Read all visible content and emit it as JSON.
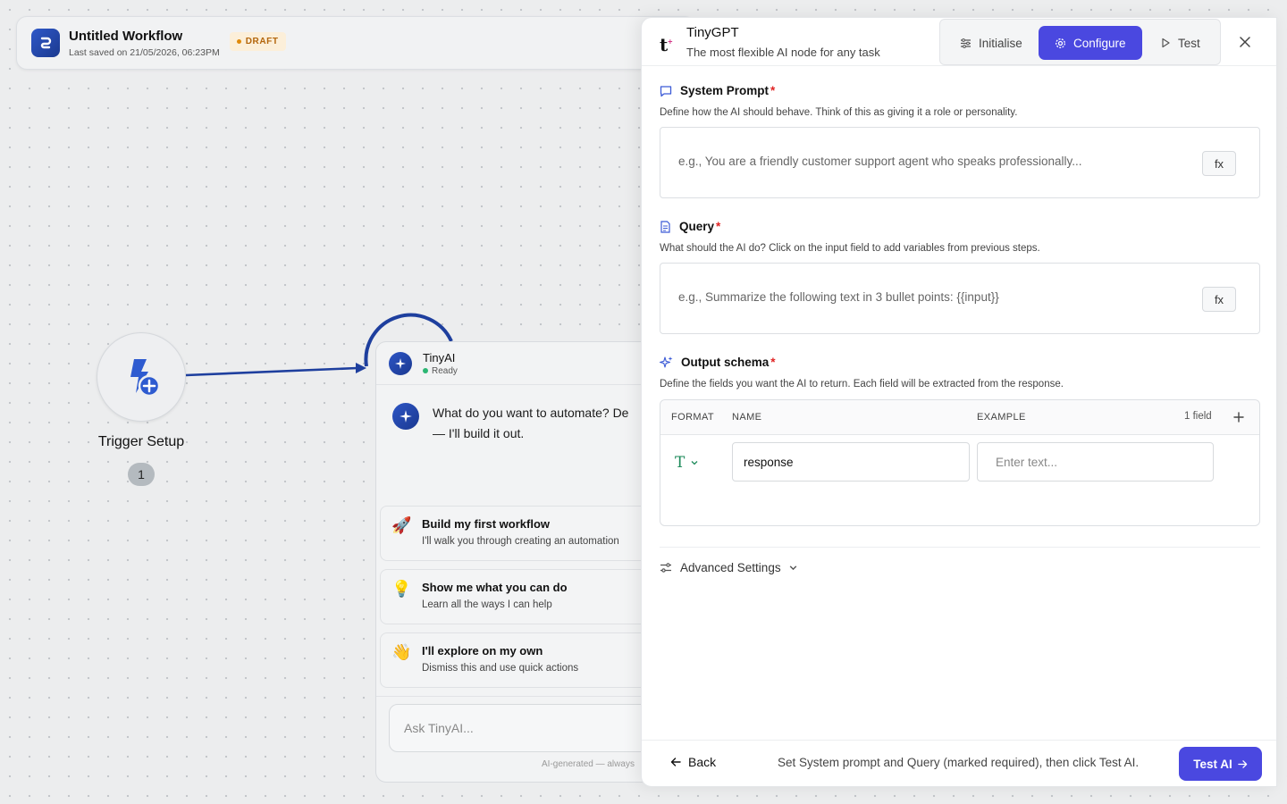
{
  "workflow": {
    "title": "Untitled Workflow",
    "last_saved": "Last saved on 21/05/2026, 06:23PM",
    "status_badge": "DRAFT",
    "logo_icon": "workflow-logo-icon"
  },
  "canvas": {
    "trigger": {
      "label": "Trigger Setup",
      "count": "1",
      "icon": "lightning-plus-icon"
    },
    "chat": {
      "name": "TinyAI",
      "status": "Ready",
      "message": "What do you want to automate? Describe it — I'll build it out.",
      "message_line1": "What do you want to automate? De",
      "message_line2": "— I'll build it out.",
      "suggestions": [
        {
          "emoji": "🚀",
          "title": "Build my first workflow",
          "desc": "I'll walk you through creating an automation"
        },
        {
          "emoji": "💡",
          "title": "Show me what you can do",
          "desc": "Learn all the ways I can help"
        },
        {
          "emoji": "👋",
          "title": "I'll explore on my own",
          "desc": "Dismiss this and use quick actions"
        }
      ],
      "input_placeholder": "Ask TinyAI...",
      "footer_note": "AI-generated — always"
    }
  },
  "panel": {
    "logo": "t",
    "title": "TinyGPT",
    "subtitle": "The most flexible AI node for any task",
    "tabs": [
      {
        "label": "Initialise",
        "icon": "sliders-icon",
        "active": false
      },
      {
        "label": "Configure",
        "icon": "gear-icon",
        "active": true
      },
      {
        "label": "Test",
        "icon": "play-icon",
        "active": false
      }
    ],
    "system_prompt": {
      "label": "System Prompt",
      "required": "*",
      "desc": "Define how the AI should behave. Think of this as giving it a role or personality.",
      "placeholder": "e.g., You are a friendly customer support agent who speaks professionally...",
      "fx": "fx"
    },
    "query": {
      "label": "Query",
      "required": "*",
      "desc": "What should the AI do? Click on the input field to add variables from previous steps.",
      "placeholder": "e.g., Summarize the following text in 3 bullet points: {{input}}",
      "fx": "fx"
    },
    "output_schema": {
      "label": "Output schema",
      "required": "*",
      "desc": "Define the fields you want the AI to return. Each field will be extracted from the response.",
      "columns": {
        "format": "FORMAT",
        "name": "NAME",
        "example": "EXAMPLE"
      },
      "field_count": "1 field",
      "rows": [
        {
          "format": "T",
          "name": "response",
          "example_placeholder": "Enter text..."
        }
      ]
    },
    "advanced_settings": "Advanced Settings",
    "footer": {
      "back": "Back",
      "hint": "Set System prompt and Query (marked required), then click Test AI.",
      "test_button": "Test AI"
    }
  },
  "colors": {
    "accent": "#4a48e0",
    "draft_bg": "#fcefd9",
    "draft_text": "#b3650b",
    "required": "#e02424",
    "edge": "#1e3f9e"
  }
}
